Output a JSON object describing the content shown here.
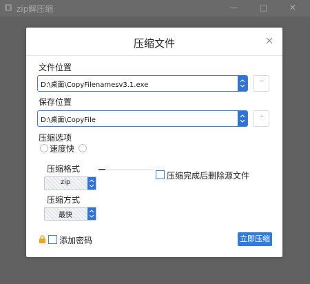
{
  "app": {
    "title": "zip解压缩",
    "controls": "— □ ✕"
  },
  "dialog": {
    "title": "压缩文件",
    "file_location_label": "文件位置",
    "file_location_value": "D:\\桌面\\CopyFilenamesv3.1.exe",
    "save_location_label": "保存位置",
    "save_location_value": "D:\\桌面\\CopyFile",
    "browse_label": "···",
    "options_label": "压缩选项",
    "speed_label": "速度快",
    "format_label": "压缩格式",
    "format_value": "zip",
    "method_label": "压缩方式",
    "method_value": "最快",
    "delete_source_label": "压缩完成后删除源文件",
    "add_password_label": "添加密码",
    "compress_button": "立即压缩"
  },
  "colors": {
    "accent": "#2f72d8",
    "button": "#2f7be4",
    "lock": "#f0a321"
  },
  "icons": {
    "close": "close-icon",
    "dropdown": "chevron-up-down-icon",
    "lock": "lock-icon",
    "more": "ellipsis-icon"
  }
}
